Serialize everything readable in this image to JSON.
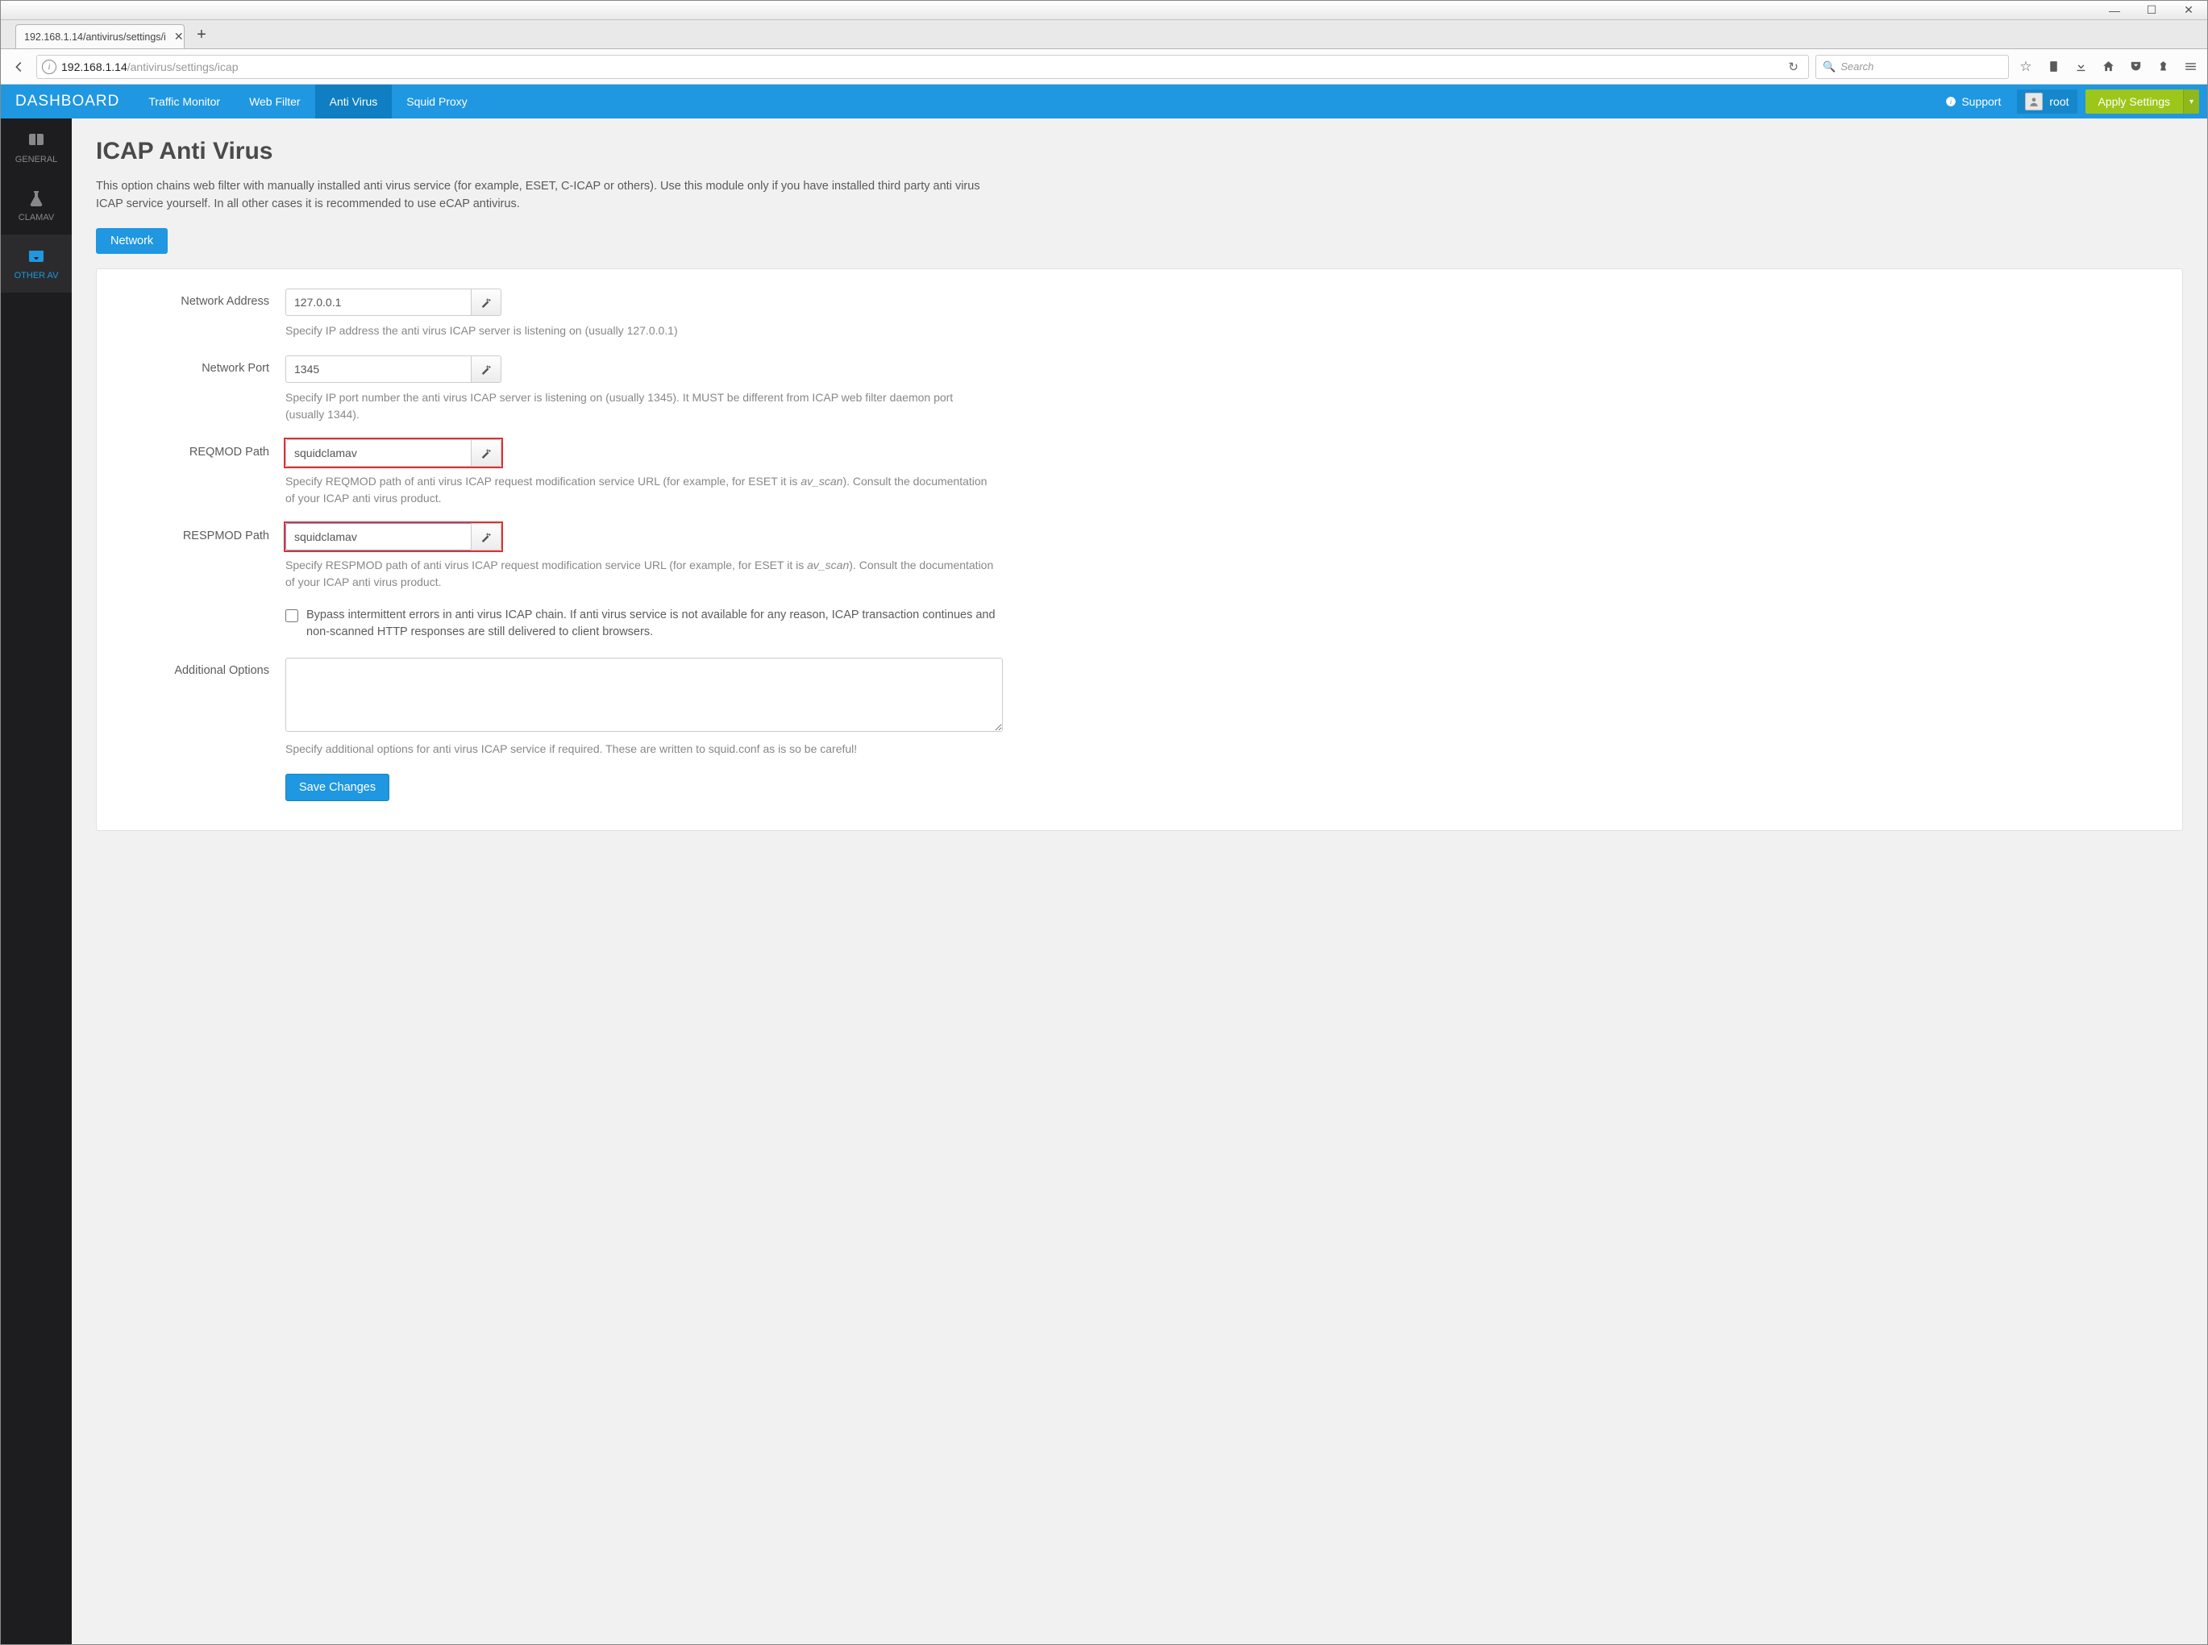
{
  "browser": {
    "tab_title": "192.168.1.14/antivirus/settings/i",
    "url_host": "192.168.1.14",
    "url_path": "/antivirus/settings/icap",
    "search_placeholder": "Search"
  },
  "topnav": {
    "brand": "DASHBOARD",
    "items": [
      "Traffic Monitor",
      "Web Filter",
      "Anti Virus",
      "Squid Proxy"
    ],
    "active_index": 2,
    "support": "Support",
    "user": "root",
    "apply": "Apply Settings"
  },
  "sidenav": {
    "items": [
      {
        "label": "GENERAL",
        "icon": "book"
      },
      {
        "label": "CLAMAV",
        "icon": "flask"
      },
      {
        "label": "OTHER AV",
        "icon": "inbox"
      }
    ],
    "active_index": 2
  },
  "page": {
    "title": "ICAP Anti Virus",
    "intro": "This option chains web filter with manually installed anti virus service (for example, ESET, C-ICAP or others). Use this module only if you have installed third party anti virus ICAP service yourself. In all other cases it is recommended to use eCAP antivirus.",
    "tab": "Network"
  },
  "form": {
    "network_address": {
      "label": "Network Address",
      "value": "127.0.0.1",
      "help": "Specify IP address the anti virus ICAP server is listening on (usually 127.0.0.1)"
    },
    "network_port": {
      "label": "Network Port",
      "value": "1345",
      "help": "Specify IP port number the anti virus ICAP server is listening on (usually 1345). It MUST be different from ICAP web filter daemon port (usually 1344)."
    },
    "reqmod": {
      "label": "REQMOD Path",
      "value": "squidclamav",
      "help_pre": "Specify REQMOD path of anti virus ICAP request modification service URL (for example, for ESET it is ",
      "help_em": "av_scan",
      "help_post": "). Consult the documentation of your ICAP anti virus product."
    },
    "respmod": {
      "label": "RESPMOD Path",
      "value": "squidclamav",
      "help_pre": "Specify RESPMOD path of anti virus ICAP request modification service URL (for example, for ESET it is ",
      "help_em": "av_scan",
      "help_post": "). Consult the documentation of your ICAP anti virus product."
    },
    "bypass": {
      "label": "Bypass intermittent errors in anti virus ICAP chain. If anti virus service is not available for any reason, ICAP transaction continues and non-scanned HTTP responses are still delivered to client browsers.",
      "checked": false
    },
    "additional": {
      "label": "Additional Options",
      "value": "",
      "help": "Specify additional options for anti virus ICAP service if required. These are written to squid.conf as is so be careful!"
    },
    "save": "Save Changes"
  }
}
